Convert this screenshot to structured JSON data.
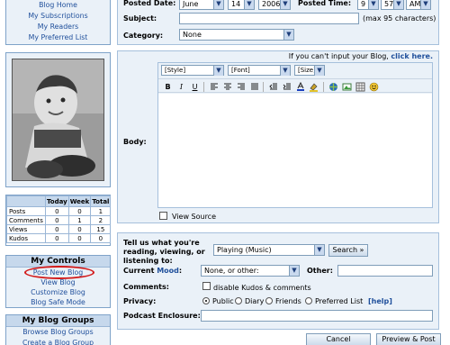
{
  "sidebar": {
    "top_links": [
      "Blog Home",
      "My Subscriptions",
      "My Readers",
      "My Preferred List"
    ],
    "stats": {
      "headers": [
        "",
        "Today",
        "Week",
        "Total"
      ],
      "rows": [
        [
          "Posts",
          "0",
          "0",
          "1"
        ],
        [
          "Comments",
          "0",
          "1",
          "2"
        ],
        [
          "Views",
          "0",
          "0",
          "15"
        ],
        [
          "Kudos",
          "0",
          "0",
          "0"
        ]
      ]
    },
    "controls": {
      "title": "My Controls",
      "items": [
        "Post New Blog",
        "View Blog",
        "Customize Blog",
        "Blog Safe Mode"
      ]
    },
    "groups": {
      "title": "My Blog Groups",
      "items": [
        "Browse Blog Groups",
        "Create a Blog Group"
      ]
    }
  },
  "form": {
    "posted_date_label": "Posted Date:",
    "date_month": "June",
    "date_day": "14",
    "date_year": "2006",
    "posted_time_label": "Posted Time:",
    "time_hour": "9",
    "time_min": "57",
    "time_ampm": "AM",
    "subject_label": "Subject:",
    "subject_value": "",
    "subject_note": "(max 95 characters)",
    "category_label": "Category:",
    "category_value": "None",
    "cant_input_text": "If you can't input your Blog, ",
    "click_here": "click here.",
    "body_label": "Body:",
    "style_select": "[Style]",
    "font_select": "[Font]",
    "size_select": "[Size]",
    "view_source": "View Source",
    "tell_us_label": "Tell us what you're reading, viewing, or listening to:",
    "playing_value": "Playing (Music)",
    "search_button": "Search »",
    "mood_label_a": "Current ",
    "mood_label_b": "Mood",
    "mood_label_c": ":",
    "mood_value": "None, or other:",
    "other_label": "Other:",
    "comments_label": "Comments:",
    "disable_kudos": "disable Kudos & comments",
    "privacy_label": "Privacy:",
    "privacy_options": [
      "Public",
      "Diary",
      "Friends",
      "Preferred List"
    ],
    "privacy_selected": "Public",
    "help_link": "[help]",
    "podcast_label": "Podcast Enclosure:",
    "cancel_button": "Cancel",
    "preview_button": "Preview & Post"
  },
  "toolbar": {
    "icons": [
      "bold-icon",
      "italic-icon",
      "underline-icon",
      "align-left-icon",
      "align-center-icon",
      "align-right-icon",
      "justify-icon",
      "outdent-icon",
      "indent-icon",
      "text-color-icon",
      "highlight-icon",
      "link-icon",
      "image-icon",
      "table-icon",
      "smiley-icon"
    ]
  },
  "colors": {
    "panel_bg": "#eaf1f8",
    "border": "#a6c0dc",
    "link": "#1f4f9b",
    "highlight_oval": "#d31a1a"
  }
}
